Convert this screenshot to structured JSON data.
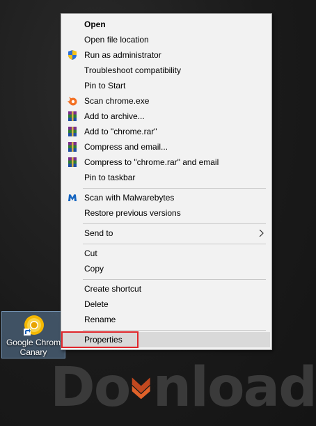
{
  "menu": {
    "items": [
      {
        "label": "Open",
        "icon": "",
        "bold": true
      },
      {
        "label": "Open file location",
        "icon": ""
      },
      {
        "label": "Run as administrator",
        "icon": "uac-shield-icon"
      },
      {
        "label": "Troubleshoot compatibility",
        "icon": ""
      },
      {
        "label": "Pin to Start",
        "icon": ""
      },
      {
        "label": "Scan chrome.exe",
        "icon": "avast-icon"
      },
      {
        "label": "Add to archive...",
        "icon": "winrar-icon"
      },
      {
        "label": "Add to \"chrome.rar\"",
        "icon": "winrar-icon"
      },
      {
        "label": "Compress and email...",
        "icon": "winrar-icon"
      },
      {
        "label": "Compress to \"chrome.rar\" and email",
        "icon": "winrar-icon"
      },
      {
        "label": "Pin to taskbar",
        "icon": ""
      },
      {
        "label": "Scan with Malwarebytes",
        "icon": "malwarebytes-icon"
      },
      {
        "label": "Restore previous versions",
        "icon": ""
      },
      {
        "label": "Send to",
        "icon": "",
        "submenu": true
      },
      {
        "label": "Cut",
        "icon": ""
      },
      {
        "label": "Copy",
        "icon": ""
      },
      {
        "label": "Create shortcut",
        "icon": ""
      },
      {
        "label": "Delete",
        "icon": ""
      },
      {
        "label": "Rename",
        "icon": ""
      },
      {
        "label": "Properties",
        "icon": "",
        "highlighted": true
      }
    ]
  },
  "desktop_icon": {
    "label": "Google Chrom\nCanary",
    "icon": "chrome-canary-icon"
  },
  "watermark": {
    "text_left": "Do",
    "text_right": "nload"
  },
  "colors": {
    "highlight_box": "#e0262b",
    "menu_bg": "#f2f2f2",
    "hover_bg": "#d9d9d9"
  }
}
